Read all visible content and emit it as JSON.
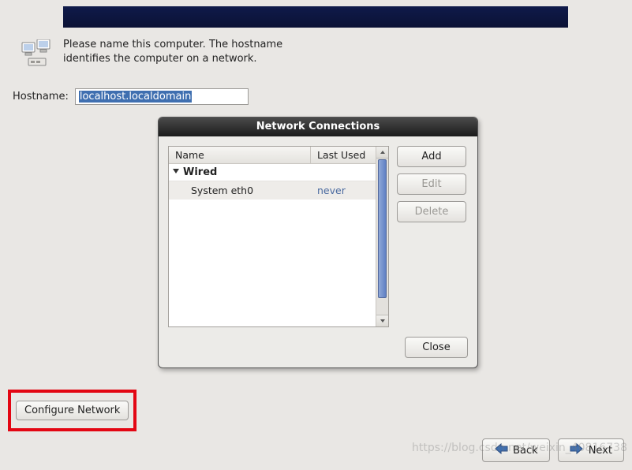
{
  "banner": {},
  "intro": {
    "text": "Please name this computer.  The hostname identifies the computer on a network."
  },
  "hostname": {
    "label": "Hostname:",
    "value": "localhost.localdomain"
  },
  "dialog": {
    "title": "Network Connections",
    "columns": {
      "name": "Name",
      "last": "Last Used"
    },
    "group": "Wired",
    "items": [
      {
        "name": "System eth0",
        "last": "never"
      }
    ],
    "buttons": {
      "add": "Add",
      "edit": "Edit",
      "delete": "Delete",
      "close": "Close"
    }
  },
  "configure": {
    "label": "Configure Network"
  },
  "nav": {
    "back": "Back",
    "next": "Next"
  },
  "watermark": "https://blog.csdn.net/weixin_40816738"
}
